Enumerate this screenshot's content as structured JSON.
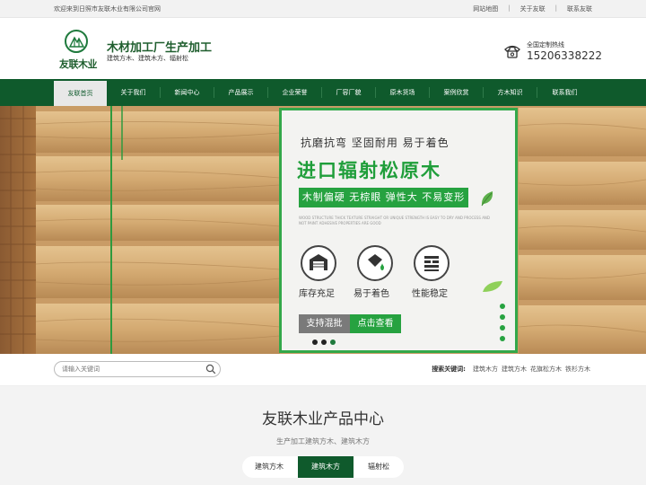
{
  "topbar": {
    "welcome": "欢迎来到日照市友联木业有限公司官网",
    "links": [
      "网站地图",
      "关于友联",
      "联系友联"
    ],
    "separator": "|"
  },
  "header": {
    "logo_text": "友联木业",
    "title": "木材加工厂生产加工",
    "subtitle": "建筑方木、建筑木方、辐射松",
    "hotline_label": "全国定制热线",
    "hotline_number": "15206338222",
    "icons": [
      "logo-mark-icon",
      "phone-icon"
    ]
  },
  "nav": {
    "items": [
      "友联首页",
      "关于我们",
      "新闻中心",
      "产品展示",
      "企业荣誉",
      "厂容厂貌",
      "原木货场",
      "案例欣赏",
      "方木知识",
      "联系我们"
    ],
    "active_index": 0
  },
  "banner": {
    "line1": "抗磨抗弯 坚固耐用 易于着色",
    "line2": "进口辐射松原木",
    "ribbon": "木制偏硬 无棕眼 弹性大 不易变形",
    "fine_print": "WOOD STRUCTURE THICK TEXTURE STRAIGHT OR UNIQUE STRENGTH IS EASY TO DRY AND PROCESS AND NOT PAINT ADHESIVE PROPERTIES ARE GOOD",
    "features": [
      {
        "label": "库存充足",
        "icon": "warehouse-icon"
      },
      {
        "label": "易于着色",
        "icon": "paint-bucket-icon"
      },
      {
        "label": "性能稳定",
        "icon": "stack-icon"
      }
    ],
    "btn_mix": "支持混批",
    "btn_view": "点击查看",
    "slides_count": 3,
    "active_slide": 0,
    "colors": {
      "green": "#26a240",
      "dark_green": "#0f5a2c"
    }
  },
  "search": {
    "placeholder": "请输入关键词",
    "hot_label": "搜索关键词:",
    "keywords": [
      "建筑木方",
      "建筑方木",
      "花旗松方木",
      "铁杉方木"
    ]
  },
  "product": {
    "title": "友联木业产品中心",
    "subtitle": "生产加工建筑方木、建筑木方",
    "tabs": [
      "建筑方木",
      "建筑木方",
      "辐射松"
    ],
    "active_tab": 1
  }
}
